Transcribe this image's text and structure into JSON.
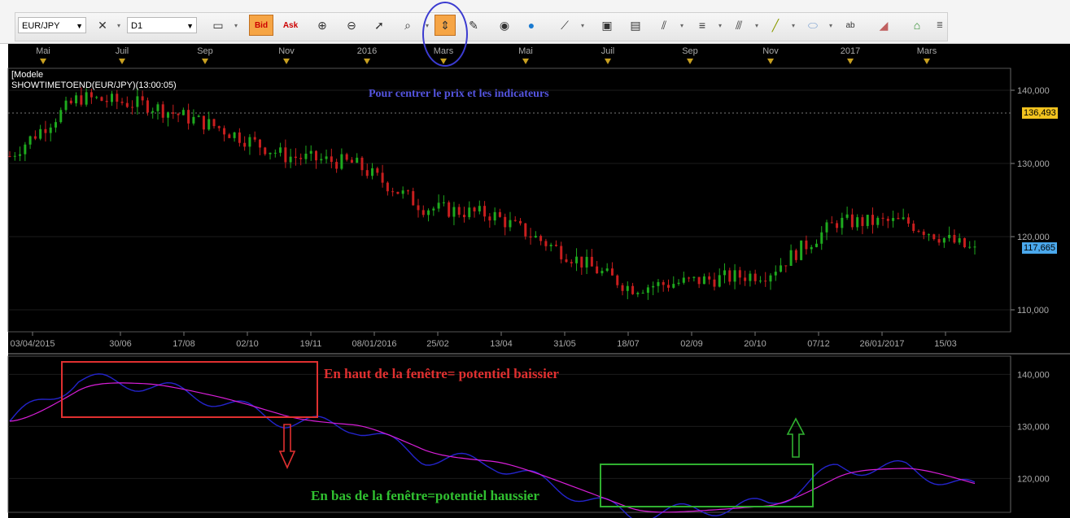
{
  "toolbar": {
    "symbol": "EUR/JPY",
    "timeframe": "D1",
    "bid_label": "Bid",
    "ask_label": "Ask"
  },
  "chart": {
    "source_line1": "[Modele",
    "source_line2": "SHOWTIMETOEND(EUR/JPY)(13:00:05)",
    "center_note": "Pour centrer le prix et les indicateurs",
    "month_labels": [
      "Mai",
      "Juil",
      "Sep",
      "Nov",
      "2016",
      "Mars",
      "Mai",
      "Juil",
      "Sep",
      "Nov",
      "2017",
      "Mars"
    ],
    "date_labels": [
      "03/04/2015",
      "30/06",
      "17/08",
      "02/10",
      "19/11",
      "08/01/2016",
      "25/02",
      "13/04",
      "31/05",
      "18/07",
      "02/09",
      "20/10",
      "07/12",
      "26/01/2017",
      "15/03"
    ],
    "price_axis": [
      "140,000",
      "130,000",
      "120,000",
      "110,000"
    ],
    "price_tag_current": "136,493",
    "price_tag_last": "117,665",
    "colors": {
      "up": "#1eaa1e",
      "down": "#c81e1e",
      "sma": "#d81ed8",
      "line": "#2424cc"
    }
  },
  "indicator": {
    "axis": [
      "140,000",
      "130,000",
      "120,000"
    ],
    "note_top": "En haut de la fenêtre= potentiel baissier",
    "note_bottom": "En bas de la fenêtre=potentiel haussier"
  },
  "chart_data": {
    "type": "line",
    "x": [
      "03/04/2015",
      "30/06",
      "17/08",
      "02/10",
      "19/11",
      "08/01/2016",
      "25/02",
      "13/04",
      "31/05",
      "18/07",
      "02/09",
      "20/10",
      "07/12",
      "26/01/2017",
      "15/03"
    ],
    "series": [
      {
        "values": [
          131,
          139,
          138,
          135,
          131,
          130,
          124,
          123,
          118,
          113,
          114,
          115,
          122,
          122,
          118
        ]
      }
    ],
    "ylim": [
      107,
      143
    ]
  }
}
